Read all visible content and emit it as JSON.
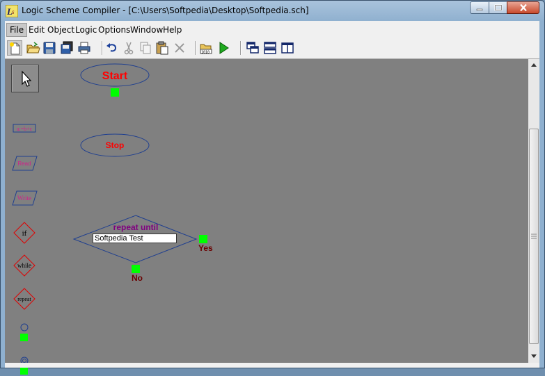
{
  "window": {
    "title": "Logic Scheme Compiler - [C:\\Users\\Softpedia\\Desktop\\Softpedia.sch]"
  },
  "menu": {
    "items": [
      "File",
      "Edit",
      "Object",
      "Logic",
      "Options",
      "Window",
      "Help"
    ]
  },
  "toolbar": {
    "buttons": [
      "new-icon",
      "open-icon",
      "save-icon",
      "save-all-icon",
      "print-icon",
      "undo-icon",
      "cut-icon",
      "copy-icon",
      "paste-icon",
      "delete-icon",
      "compile-icon",
      "run-icon",
      "cascade-icon",
      "tile-horizontal-icon",
      "tile-vertical-icon"
    ]
  },
  "palette": {
    "items": [
      {
        "name": "pointer-tool",
        "label": ""
      },
      {
        "name": "assign-block",
        "label": "a:=b+c"
      },
      {
        "name": "read-block",
        "label": "Read"
      },
      {
        "name": "write-block",
        "label": "Write"
      },
      {
        "name": "if-block",
        "label": "if"
      },
      {
        "name": "while-block",
        "label": "while"
      },
      {
        "name": "repeat-block",
        "label": "repeat"
      },
      {
        "name": "connector-block",
        "label": ""
      },
      {
        "name": "end-connector-block",
        "label": ""
      }
    ]
  },
  "canvas": {
    "start_label": "Start",
    "stop_label": "Stop",
    "decision_title": "repeat until",
    "decision_input_value": "Softpedia Test",
    "yes_label": "Yes",
    "no_label": "No"
  },
  "colors": {
    "canvas_bg": "#808080",
    "shape_outline": "#1f3f8f",
    "terminal_text": "#ff0000",
    "decision_title": "#800080",
    "port_green": "#00ff00",
    "branch_label": "#6a0000"
  }
}
